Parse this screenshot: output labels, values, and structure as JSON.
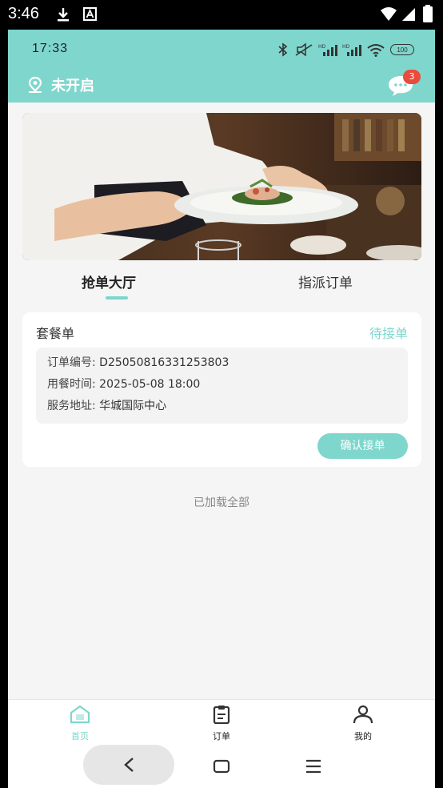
{
  "system": {
    "time": "3:46"
  },
  "app": {
    "inner_time": "17:33",
    "battery": "100",
    "location": {
      "label": "未开启"
    },
    "message_badge": "3"
  },
  "tabs": [
    {
      "label": "抢单大厅",
      "active": true
    },
    {
      "label": "指派订单",
      "active": false
    }
  ],
  "order": {
    "title": "套餐单",
    "status": "待接单",
    "rows": [
      {
        "key": "订单编号",
        "value": "D25050816331253803"
      },
      {
        "key": "用餐时间",
        "value": "2025-05-08 18:00"
      },
      {
        "key": "服务地址",
        "value": "华城国际中心"
      }
    ],
    "confirm_label": "确认接单"
  },
  "footer_text": "已加载全部",
  "bottom_nav": [
    {
      "label": "首页",
      "icon": "home-icon",
      "active": true
    },
    {
      "label": "订单",
      "icon": "clipboard-icon",
      "active": false
    },
    {
      "label": "我的",
      "icon": "user-icon",
      "active": false
    }
  ],
  "colors": {
    "accent": "#7fd6cd",
    "badge": "#e94b3c"
  }
}
